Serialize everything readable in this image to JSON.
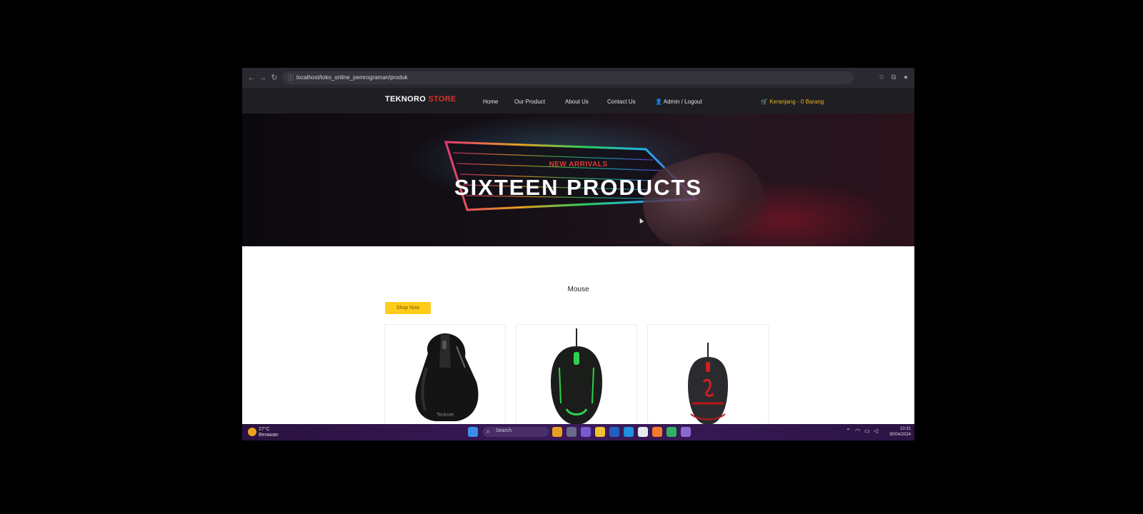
{
  "browser": {
    "url": "localhost/toko_online_pemrograman/produk",
    "back_icon": "arrow-left-icon",
    "forward_icon": "arrow-right-icon",
    "reload_icon": "reload-icon"
  },
  "site": {
    "logo_part1": "TEKNORO",
    "logo_part2": "STORE",
    "nav": [
      "Home",
      "Our Product",
      "About Us",
      "Contact Us",
      "Admin / Logout"
    ],
    "cart_label": "Keranjang - 0 Barang"
  },
  "hero": {
    "subtitle": "NEW ARRIVALS",
    "title": "SIXTEEN PRODUCTS"
  },
  "products": {
    "category_title": "Mouse",
    "tag_label": "Shop Now"
  },
  "taskbar": {
    "search_placeholder": "Search",
    "weather_temp": "27°C",
    "weather_desc": "Berawan",
    "time": "10:31",
    "date": "30/04/2024"
  },
  "colors": {
    "accent_red": "#e0302a",
    "cart_yellow": "#e8b020",
    "tag_yellow": "#ffcc1a",
    "nav_bg": "#1f1e22"
  }
}
